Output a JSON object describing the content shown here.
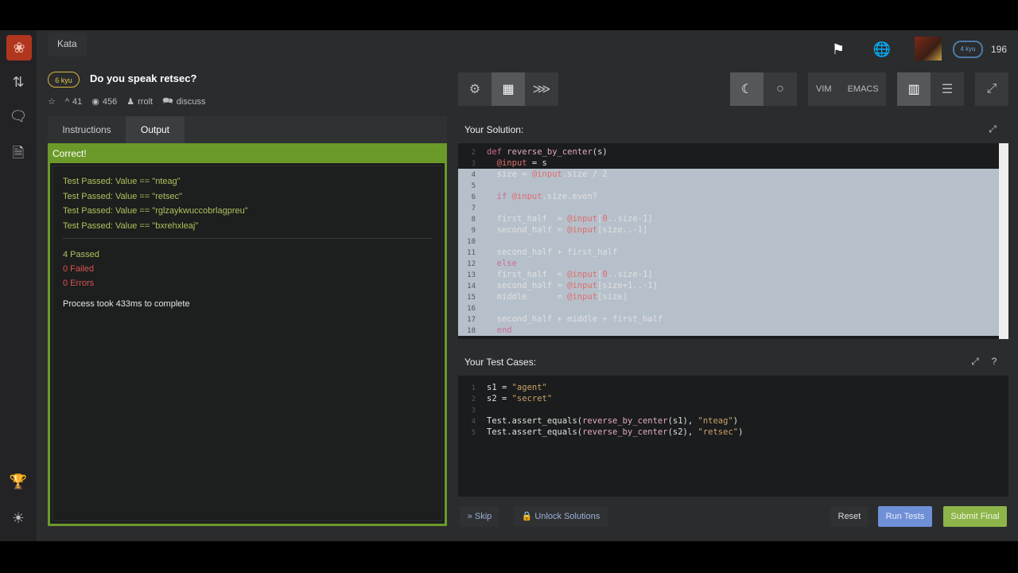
{
  "header": {
    "breadcrumb": "Kata",
    "kyu_label": "6 kyu",
    "kata_title": "Do you speak retsec?",
    "stats": {
      "satisfaction": "41",
      "completed": "456",
      "author": "rrolt",
      "discuss": "discuss"
    },
    "honor": "196",
    "rank_badge": "4 kyu"
  },
  "toolbar": {
    "vim_label": "VIM",
    "emacs_label": "EMACS"
  },
  "left_panel": {
    "tabs": [
      "Instructions",
      "Output"
    ],
    "active_tab": "Output",
    "result_header": "Correct!",
    "test_results": [
      "Test Passed: Value == \"nteag\"",
      "Test Passed: Value == \"retsec\"",
      "Test Passed: Value == \"rglzaykwuccobrlagpreu\"",
      "Test Passed: Value == \"bxrehxleaj\""
    ],
    "passed": "4 Passed",
    "failed": "0 Failed",
    "errors": "0 Errors",
    "process_time": "Process took 433ms to complete"
  },
  "solution": {
    "title": "Your Solution:",
    "lines": [
      {
        "n": "2",
        "text": "def reverse_by_center(s)"
      },
      {
        "n": "3",
        "text": "  @input = s"
      },
      {
        "n": "4",
        "text": "  size = @input.size / 2"
      },
      {
        "n": "5",
        "text": ""
      },
      {
        "n": "6",
        "text": "  if @input.size.even?"
      },
      {
        "n": "7",
        "text": ""
      },
      {
        "n": "8",
        "text": "  first_half  = @input[0..size-1]"
      },
      {
        "n": "9",
        "text": "  second_half = @input[size..-1]"
      },
      {
        "n": "10",
        "text": ""
      },
      {
        "n": "11",
        "text": "  second_half + first_half"
      },
      {
        "n": "12",
        "text": "  else"
      },
      {
        "n": "13",
        "text": "  first_half  = @input[0..size-1]"
      },
      {
        "n": "14",
        "text": "  second_half = @input[size+1..-1]"
      },
      {
        "n": "15",
        "text": "  middle      = @input[size]"
      },
      {
        "n": "16",
        "text": ""
      },
      {
        "n": "17",
        "text": "  second_half + middle + first_half"
      },
      {
        "n": "18",
        "text": "  end"
      }
    ]
  },
  "tests": {
    "title": "Your Test Cases:",
    "lines": [
      {
        "n": "1",
        "text": "s1 = \"agent\""
      },
      {
        "n": "2",
        "text": "s2 = \"secret\""
      },
      {
        "n": "3",
        "text": ""
      },
      {
        "n": "4",
        "text": "Test.assert_equals(reverse_by_center(s1), \"nteag\")"
      },
      {
        "n": "5",
        "text": "Test.assert_equals(reverse_by_center(s2), \"retsec\")"
      }
    ]
  },
  "actions": {
    "skip": "Skip",
    "unlock": "Unlock Solutions",
    "reset": "Reset",
    "run_tests": "Run Tests",
    "submit": "Submit Final"
  },
  "colors": {
    "correct_green": "#6c9a2a",
    "run_tests_blue": "#6f8fd6",
    "submit_green": "#8db54a"
  }
}
